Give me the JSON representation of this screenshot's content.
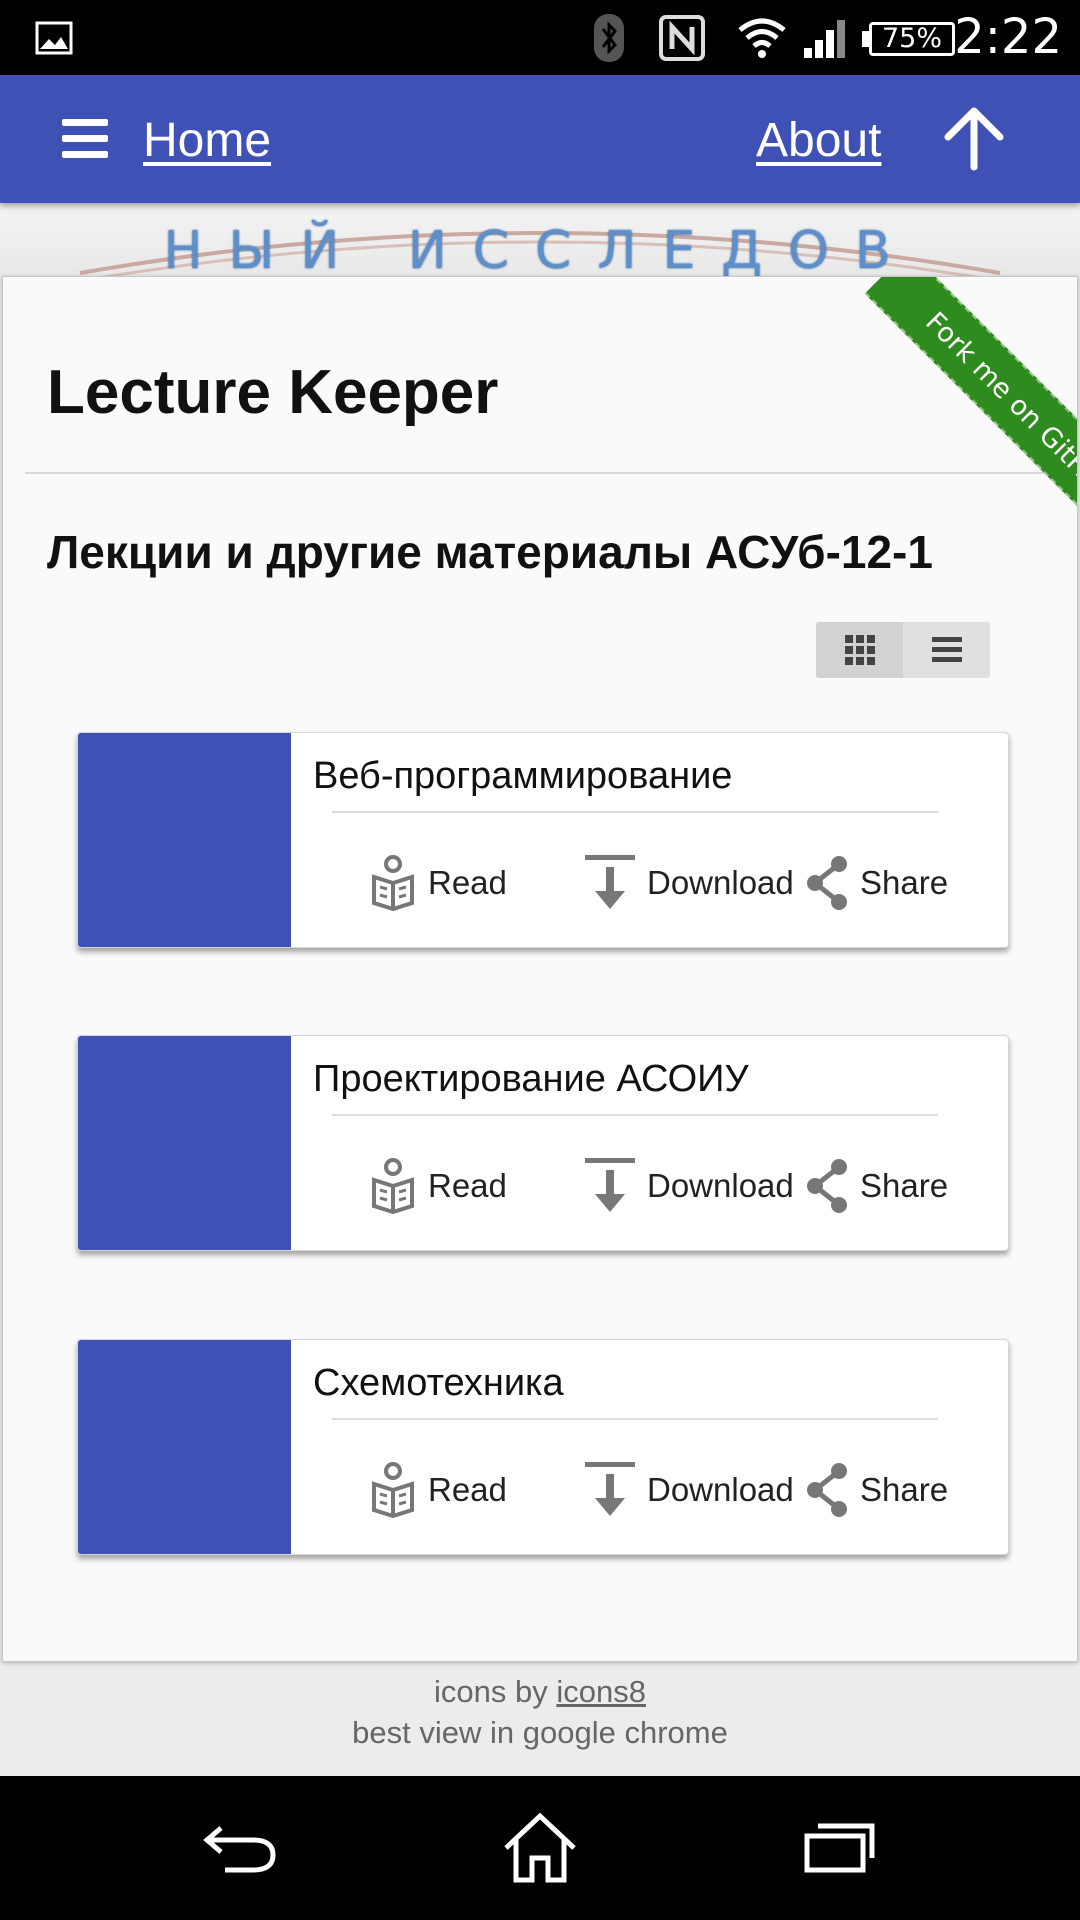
{
  "status_bar": {
    "time": "2:22",
    "battery": "75%",
    "icons": [
      "image-icon",
      "bluetooth-icon",
      "nfc-icon",
      "wifi-icon",
      "signal-icon",
      "battery-icon"
    ]
  },
  "app_bar": {
    "color": "#3f51b5",
    "menu_icon": "hamburger-menu-icon",
    "home": "Home",
    "about": "About",
    "up_icon": "arrow-up-icon"
  },
  "hero": {
    "sign_text": "НЫЙ ИССЛЕДОВ"
  },
  "page": {
    "title": "Lecture Keeper",
    "subtitle": "Лекции и другие материалы АСУб-12-1",
    "ribbon": "Fork me on GitHub",
    "view_toggle": [
      "grid-view-icon",
      "list-view-icon"
    ]
  },
  "lectures": [
    {
      "title": "Веб-программирование",
      "read": "Read",
      "download": "Download",
      "share": "Share"
    },
    {
      "title": "Проектирование АСОИУ",
      "read": "Read",
      "download": "Download",
      "share": "Share"
    },
    {
      "title": "Схемотехника",
      "read": "Read",
      "download": "Download",
      "share": "Share"
    }
  ],
  "footer": {
    "icons_prefix": "icons by ",
    "icons_link": "icons8",
    "best_view": "best view in google chrome"
  },
  "nav_bar": {
    "icons": [
      "back-icon",
      "home-icon",
      "recents-icon"
    ]
  }
}
